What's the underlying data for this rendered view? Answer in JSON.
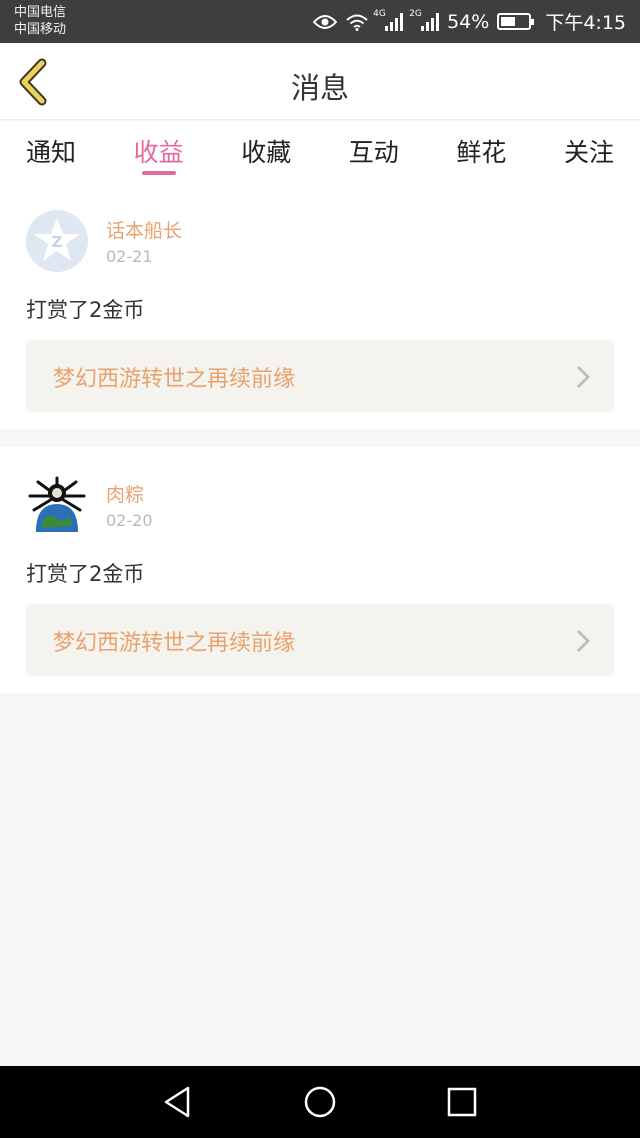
{
  "status_bar": {
    "carrier1": "中国电信",
    "carrier2": "中国移动",
    "net1": "4G",
    "net2": "2G",
    "battery": "54%",
    "battery_level": 0.54,
    "time": "下午4:15"
  },
  "header": {
    "title": "消息"
  },
  "tabs": [
    {
      "label": "通知"
    },
    {
      "label": "收益"
    },
    {
      "label": "收藏"
    },
    {
      "label": "互动"
    },
    {
      "label": "鲜花"
    },
    {
      "label": "关注"
    }
  ],
  "active_tab": "收益",
  "messages": [
    {
      "user": "话本船长",
      "date": "02-21",
      "text": "打赏了2金币",
      "book": "梦幻西游转世之再续前缘",
      "avatar_icon": "star-z-avatar-icon"
    },
    {
      "user": "肉粽",
      "date": "02-20",
      "text": "打赏了2金币",
      "book": "梦幻西游转世之再续前缘",
      "avatar_icon": "globe-creature-avatar-icon"
    }
  ],
  "colors": {
    "accent": "#e46a9b",
    "username": "#e9a16d",
    "status_bar": "#3e3e3e"
  }
}
